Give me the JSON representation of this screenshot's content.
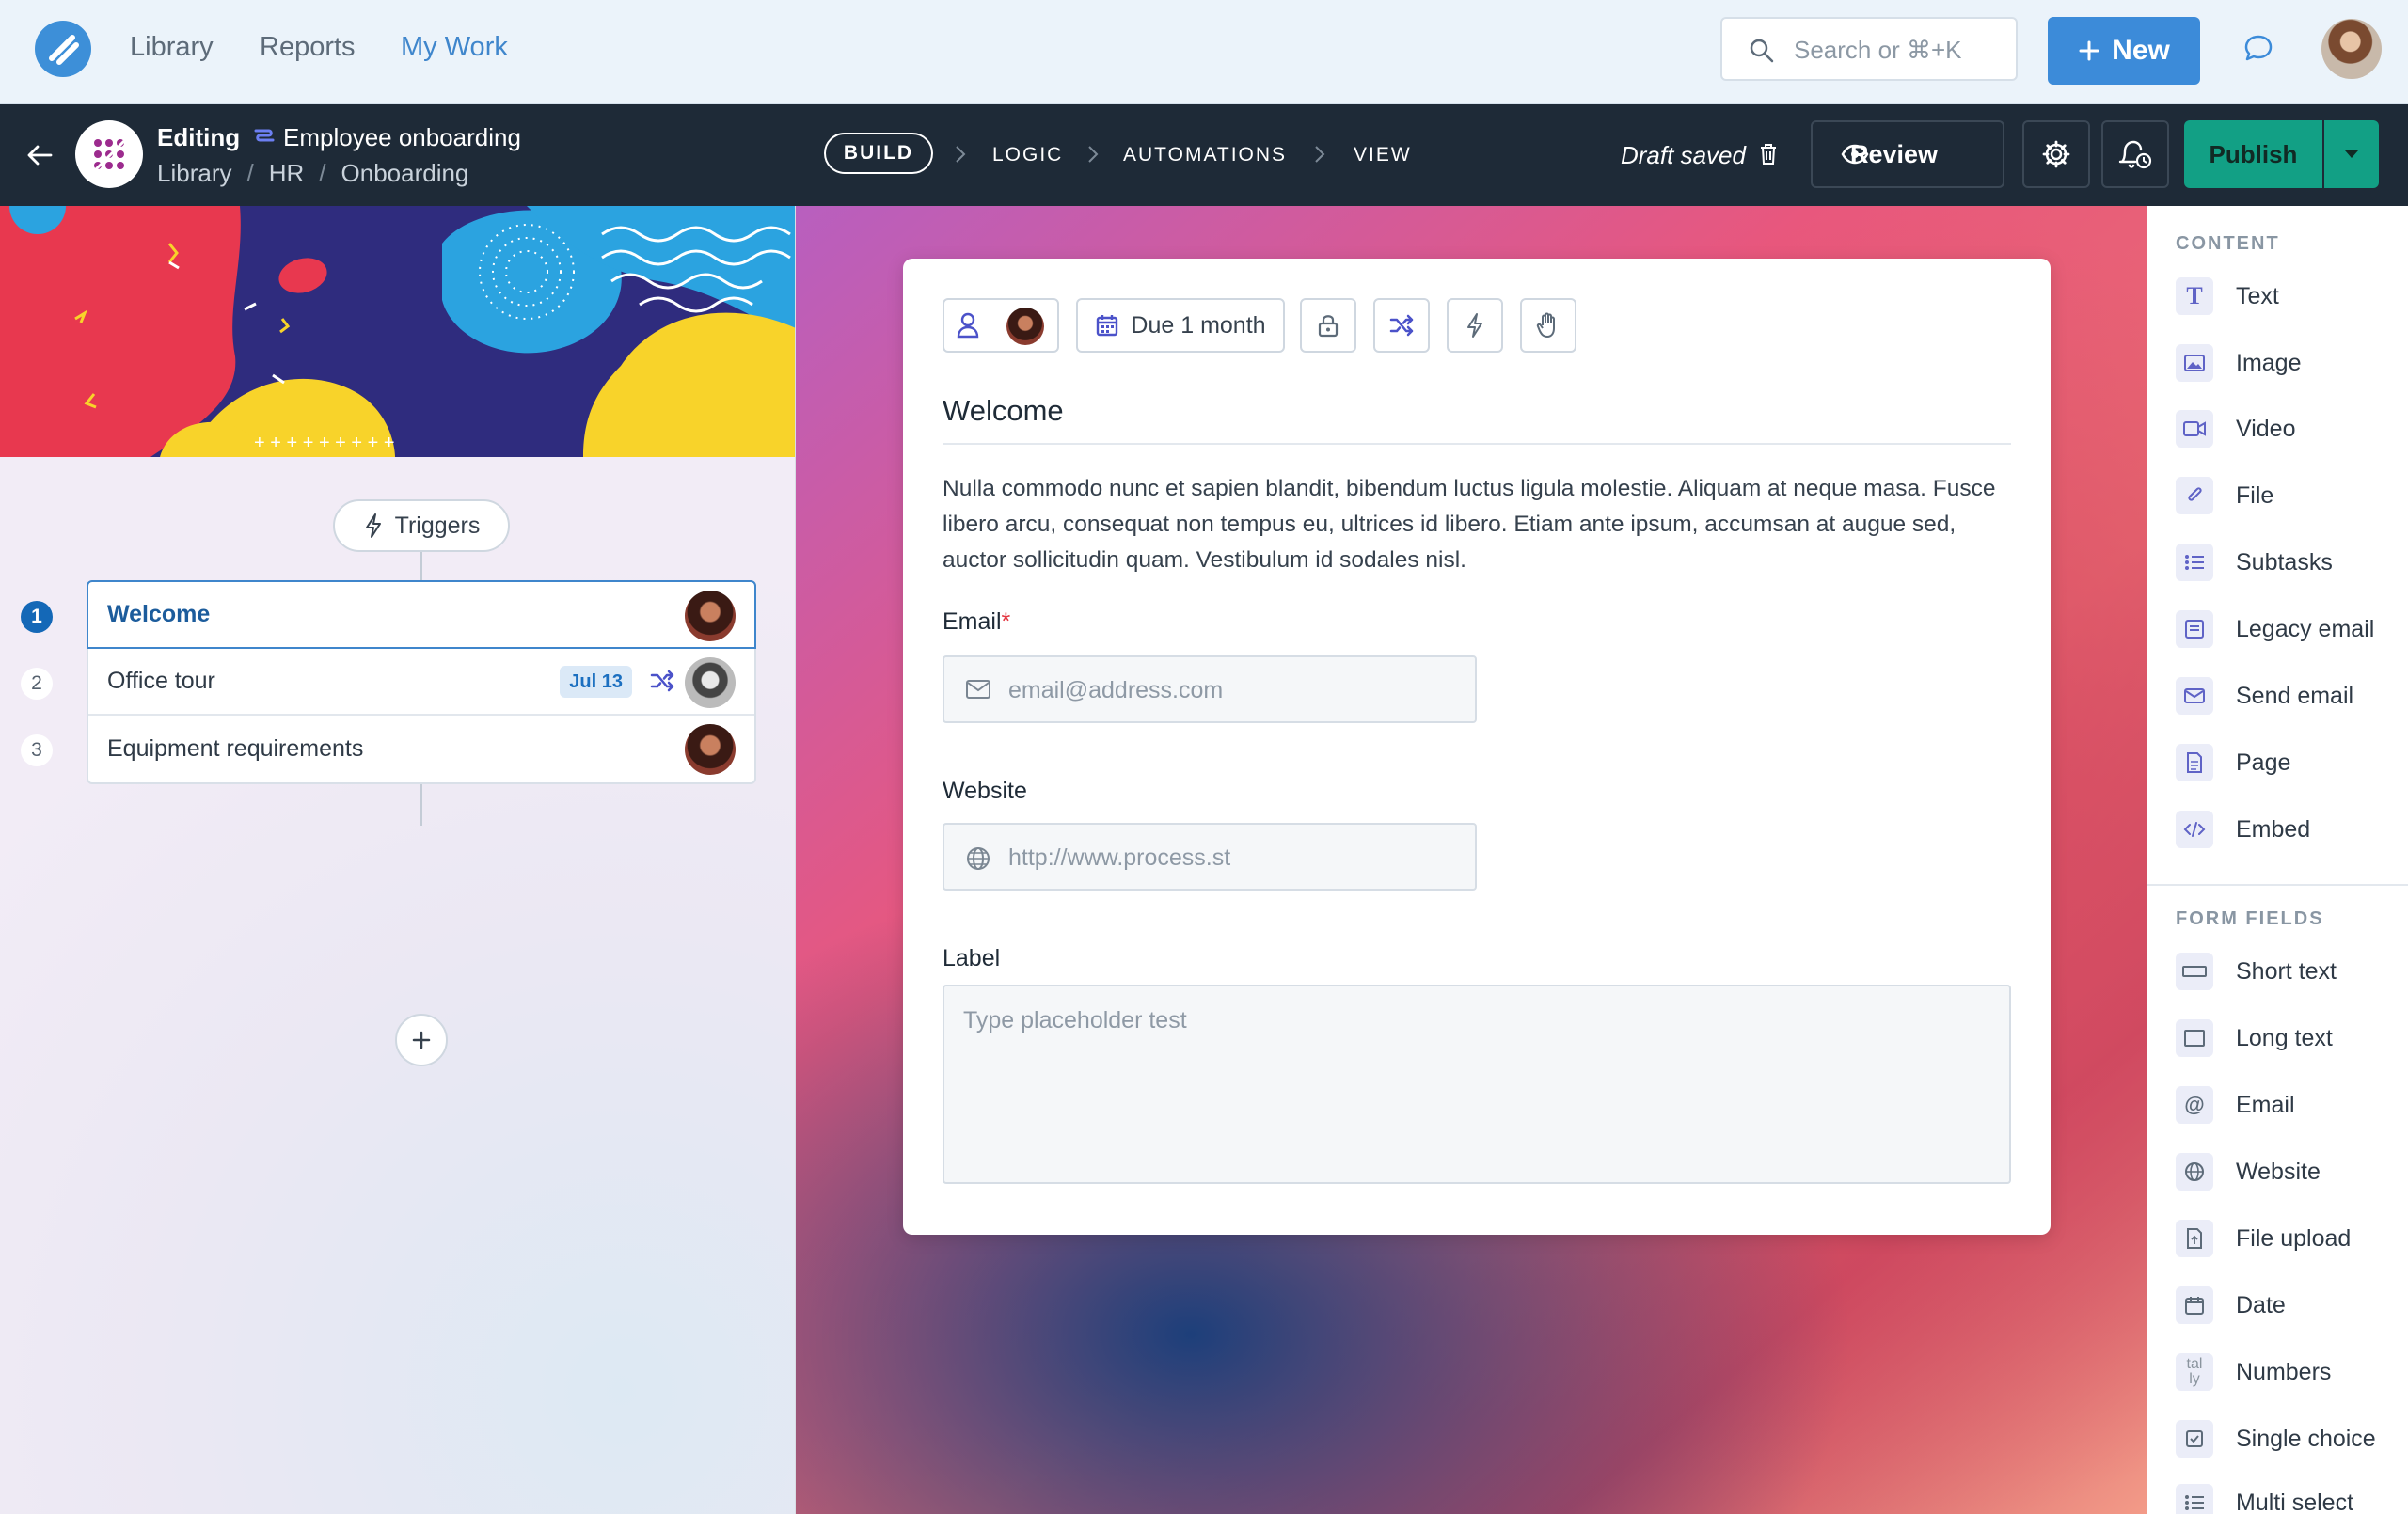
{
  "topnav": {
    "links": [
      "Library",
      "Reports",
      "My Work"
    ],
    "active_link": "My Work",
    "search_placeholder": "Search or ⌘+K",
    "new_label": "New"
  },
  "editbar": {
    "editing_label": "Editing",
    "workflow_title": "Employee onboarding",
    "breadcrumb": [
      "Library",
      "HR",
      "Onboarding"
    ],
    "tabs": [
      "BUILD",
      "LOGIC",
      "AUTOMATIONS",
      "VIEW"
    ],
    "active_tab": "BUILD",
    "draft_status": "Draft saved",
    "review_label": "Review",
    "publish_label": "Publish"
  },
  "left": {
    "triggers_label": "Triggers",
    "tasks": [
      {
        "num": "1",
        "name": "Welcome",
        "selected": true
      },
      {
        "num": "2",
        "name": "Office tour",
        "due": "Jul 13"
      },
      {
        "num": "3",
        "name": "Equipment requirements"
      }
    ]
  },
  "card": {
    "toolbar": {
      "due_label": "Due 1 month"
    },
    "title": "Welcome",
    "body": "Nulla commodo nunc et sapien blandit, bibendum luctus ligula molestie. Aliquam at neque masa. Fusce libero arcu, consequat non tempus eu, ultrices id libero. Etiam ante ipsum, accumsan at augue sed, auctor sollicitudin quam. Vestibulum id sodales nisl.",
    "fields": {
      "email": {
        "label": "Email",
        "required_mark": "*",
        "placeholder": "email@address.com"
      },
      "website": {
        "label": "Website",
        "placeholder": "http://www.process.st"
      },
      "label_field": {
        "label": "Label",
        "placeholder": "Type placeholder test"
      }
    }
  },
  "right": {
    "content_heading": "CONTENT",
    "content_items": [
      "Text",
      "Image",
      "Video",
      "File",
      "Subtasks",
      "Legacy email",
      "Send email",
      "Page",
      "Embed"
    ],
    "form_heading": "FORM FIELDS",
    "form_items": [
      "Short text",
      "Long text",
      "Email",
      "Website",
      "File upload",
      "Date",
      "Numbers",
      "Single choice",
      "Multi select"
    ]
  },
  "colors": {
    "accent": "#3c8bd9",
    "publish": "#12a085",
    "dark_bar": "#1e2a37",
    "required": "#e3343f"
  }
}
